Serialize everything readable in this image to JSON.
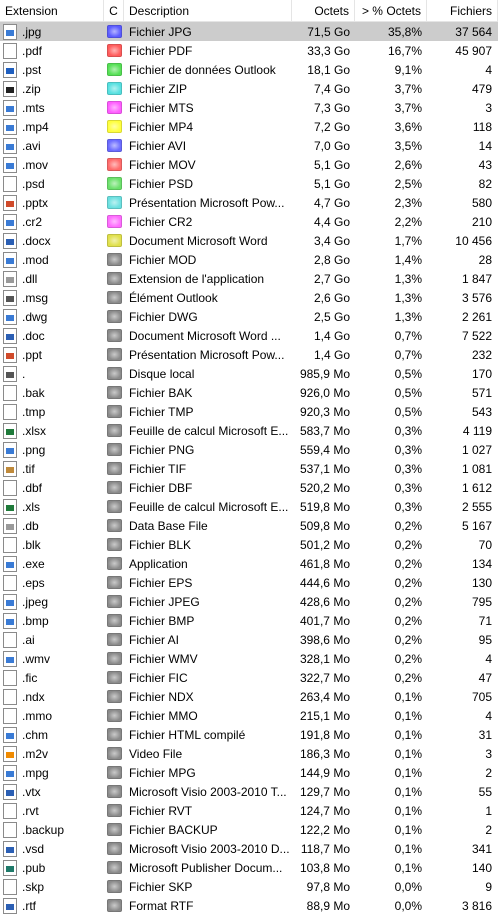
{
  "columns": {
    "extension": "Extension",
    "color": "C",
    "description": "Description",
    "octets": "Octets",
    "pct_octets": "> % Octets",
    "fichiers": "Fichiers"
  },
  "rows": [
    {
      "ext": ".jpg",
      "icon": "image-file-icon",
      "icon_color": "#3a7bd5",
      "color": "#5b5bff",
      "desc": "Fichier JPG",
      "octets": "71,5 Go",
      "pct": "35,8%",
      "files": "37 564",
      "selected": true
    },
    {
      "ext": ".pdf",
      "icon": "pdf-file-icon",
      "icon_color": "",
      "color": "#ff5b5b",
      "desc": "Fichier PDF",
      "octets": "33,3 Go",
      "pct": "16,7%",
      "files": "45 907"
    },
    {
      "ext": ".pst",
      "icon": "outlook-file-icon",
      "icon_color": "#1f5fbf",
      "color": "#55e055",
      "desc": "Fichier de données Outlook",
      "octets": "18,1 Go",
      "pct": "9,1%",
      "files": "4"
    },
    {
      "ext": ".zip",
      "icon": "archive-file-icon",
      "icon_color": "#222222",
      "color": "#55e0e0",
      "desc": "Fichier ZIP",
      "octets": "7,4 Go",
      "pct": "3,7%",
      "files": "479"
    },
    {
      "ext": ".mts",
      "icon": "video-file-icon",
      "icon_color": "#3a7bd5",
      "color": "#ff5bff",
      "desc": "Fichier MTS",
      "octets": "7,3 Go",
      "pct": "3,7%",
      "files": "3"
    },
    {
      "ext": ".mp4",
      "icon": "video-file-icon",
      "icon_color": "#3a7bd5",
      "color": "#ffff3a",
      "desc": "Fichier MP4",
      "octets": "7,2 Go",
      "pct": "3,6%",
      "files": "118"
    },
    {
      "ext": ".avi",
      "icon": "video-file-icon",
      "icon_color": "#3a7bd5",
      "color": "#6a6aff",
      "desc": "Fichier AVI",
      "octets": "7,0 Go",
      "pct": "3,5%",
      "files": "14"
    },
    {
      "ext": ".mov",
      "icon": "video-file-icon",
      "icon_color": "#3a7bd5",
      "color": "#ff6a6a",
      "desc": "Fichier MOV",
      "octets": "5,1 Go",
      "pct": "2,6%",
      "files": "43"
    },
    {
      "ext": ".psd",
      "icon": "file-icon",
      "icon_color": "",
      "color": "#6ae06a",
      "desc": "Fichier PSD",
      "octets": "5,1 Go",
      "pct": "2,5%",
      "files": "82"
    },
    {
      "ext": ".pptx",
      "icon": "powerpoint-file-icon",
      "icon_color": "#d04a2a",
      "color": "#6ae0e0",
      "desc": "Présentation Microsoft Pow...",
      "octets": "4,7 Go",
      "pct": "2,3%",
      "files": "580"
    },
    {
      "ext": ".cr2",
      "icon": "image-file-icon",
      "icon_color": "#3a7bd5",
      "color": "#ff6aff",
      "desc": "Fichier CR2",
      "octets": "4,4 Go",
      "pct": "2,2%",
      "files": "210"
    },
    {
      "ext": ".docx",
      "icon": "word-file-icon",
      "icon_color": "#2b5fb4",
      "color": "#e0e04a",
      "desc": "Document Microsoft Word",
      "octets": "3,4 Go",
      "pct": "1,7%",
      "files": "10 456"
    },
    {
      "ext": ".mod",
      "icon": "video-file-icon",
      "icon_color": "#3a7bd5",
      "color": "#8a8a8a",
      "desc": "Fichier MOD",
      "octets": "2,8 Go",
      "pct": "1,4%",
      "files": "28"
    },
    {
      "ext": ".dll",
      "icon": "gear-file-icon",
      "icon_color": "#9a9a9a",
      "color": "#8a8a8a",
      "desc": "Extension de l'application",
      "octets": "2,7 Go",
      "pct": "1,3%",
      "files": "1 847"
    },
    {
      "ext": ".msg",
      "icon": "envelope-icon",
      "icon_color": "#555555",
      "color": "#8a8a8a",
      "desc": "Élément Outlook",
      "octets": "2,6 Go",
      "pct": "1,3%",
      "files": "3 576"
    },
    {
      "ext": ".dwg",
      "icon": "image-file-icon",
      "icon_color": "#3a7bd5",
      "color": "#8a8a8a",
      "desc": "Fichier DWG",
      "octets": "2,5 Go",
      "pct": "1,3%",
      "files": "2 261"
    },
    {
      "ext": ".doc",
      "icon": "word-file-icon",
      "icon_color": "#2b5fb4",
      "color": "#8a8a8a",
      "desc": "Document Microsoft Word ...",
      "octets": "1,4 Go",
      "pct": "0,7%",
      "files": "7 522"
    },
    {
      "ext": ".ppt",
      "icon": "powerpoint-file-icon",
      "icon_color": "#d04a2a",
      "color": "#8a8a8a",
      "desc": "Présentation Microsoft Pow...",
      "octets": "1,4 Go",
      "pct": "0,7%",
      "files": "232"
    },
    {
      "ext": ".",
      "icon": "drive-icon",
      "icon_color": "#555555",
      "color": "#8a8a8a",
      "desc": "Disque local",
      "octets": "985,9 Mo",
      "pct": "0,5%",
      "files": "170"
    },
    {
      "ext": ".bak",
      "icon": "file-icon",
      "icon_color": "",
      "color": "#8a8a8a",
      "desc": "Fichier BAK",
      "octets": "926,0 Mo",
      "pct": "0,5%",
      "files": "571"
    },
    {
      "ext": ".tmp",
      "icon": "file-icon",
      "icon_color": "",
      "color": "#8a8a8a",
      "desc": "Fichier TMP",
      "octets": "920,3 Mo",
      "pct": "0,5%",
      "files": "543"
    },
    {
      "ext": ".xlsx",
      "icon": "excel-file-icon",
      "icon_color": "#1f7a3a",
      "color": "#8a8a8a",
      "desc": "Feuille de calcul Microsoft E...",
      "octets": "583,7 Mo",
      "pct": "0,3%",
      "files": "4 119"
    },
    {
      "ext": ".png",
      "icon": "image-file-icon",
      "icon_color": "#3a7bd5",
      "color": "#8a8a8a",
      "desc": "Fichier PNG",
      "octets": "559,4 Mo",
      "pct": "0,3%",
      "files": "1 027"
    },
    {
      "ext": ".tif",
      "icon": "image-file-icon",
      "icon_color": "#c08a3a",
      "color": "#8a8a8a",
      "desc": "Fichier TIF",
      "octets": "537,1 Mo",
      "pct": "0,3%",
      "files": "1 081"
    },
    {
      "ext": ".dbf",
      "icon": "file-icon",
      "icon_color": "",
      "color": "#8a8a8a",
      "desc": "Fichier DBF",
      "octets": "520,2 Mo",
      "pct": "0,3%",
      "files": "1 612"
    },
    {
      "ext": ".xls",
      "icon": "excel-file-icon",
      "icon_color": "#1f7a3a",
      "color": "#8a8a8a",
      "desc": "Feuille de calcul Microsoft E...",
      "octets": "519,8 Mo",
      "pct": "0,3%",
      "files": "2 555"
    },
    {
      "ext": ".db",
      "icon": "gear-file-icon",
      "icon_color": "#9a9a9a",
      "color": "#8a8a8a",
      "desc": "Data Base File",
      "octets": "509,8 Mo",
      "pct": "0,2%",
      "files": "5 167"
    },
    {
      "ext": ".blk",
      "icon": "file-icon",
      "icon_color": "",
      "color": "#8a8a8a",
      "desc": "Fichier BLK",
      "octets": "501,2 Mo",
      "pct": "0,2%",
      "files": "70"
    },
    {
      "ext": ".exe",
      "icon": "application-icon",
      "icon_color": "#3a7bd5",
      "color": "#8a8a8a",
      "desc": "Application",
      "octets": "461,8 Mo",
      "pct": "0,2%",
      "files": "134"
    },
    {
      "ext": ".eps",
      "icon": "file-icon",
      "icon_color": "",
      "color": "#8a8a8a",
      "desc": "Fichier EPS",
      "octets": "444,6 Mo",
      "pct": "0,2%",
      "files": "130"
    },
    {
      "ext": ".jpeg",
      "icon": "image-file-icon",
      "icon_color": "#3a7bd5",
      "color": "#8a8a8a",
      "desc": "Fichier JPEG",
      "octets": "428,6 Mo",
      "pct": "0,2%",
      "files": "795"
    },
    {
      "ext": ".bmp",
      "icon": "image-file-icon",
      "icon_color": "#3a7bd5",
      "color": "#8a8a8a",
      "desc": "Fichier BMP",
      "octets": "401,7 Mo",
      "pct": "0,2%",
      "files": "71"
    },
    {
      "ext": ".ai",
      "icon": "file-icon",
      "icon_color": "",
      "color": "#8a8a8a",
      "desc": "Fichier AI",
      "octets": "398,6 Mo",
      "pct": "0,2%",
      "files": "95"
    },
    {
      "ext": ".wmv",
      "icon": "video-file-icon",
      "icon_color": "#3a7bd5",
      "color": "#8a8a8a",
      "desc": "Fichier WMV",
      "octets": "328,1 Mo",
      "pct": "0,2%",
      "files": "4"
    },
    {
      "ext": ".fic",
      "icon": "file-icon",
      "icon_color": "",
      "color": "#8a8a8a",
      "desc": "Fichier FIC",
      "octets": "322,7 Mo",
      "pct": "0,2%",
      "files": "47"
    },
    {
      "ext": ".ndx",
      "icon": "file-icon",
      "icon_color": "",
      "color": "#8a8a8a",
      "desc": "Fichier NDX",
      "octets": "263,4 Mo",
      "pct": "0,1%",
      "files": "705"
    },
    {
      "ext": ".mmo",
      "icon": "file-icon",
      "icon_color": "",
      "color": "#8a8a8a",
      "desc": "Fichier MMO",
      "octets": "215,1 Mo",
      "pct": "0,1%",
      "files": "4"
    },
    {
      "ext": ".chm",
      "icon": "help-file-icon",
      "icon_color": "#3a7bd5",
      "color": "#8a8a8a",
      "desc": "Fichier HTML compilé",
      "octets": "191,8 Mo",
      "pct": "0,1%",
      "files": "31"
    },
    {
      "ext": ".m2v",
      "icon": "vlc-cone-icon",
      "icon_color": "#f08a00",
      "color": "#8a8a8a",
      "desc": "Video File",
      "octets": "186,3 Mo",
      "pct": "0,1%",
      "files": "3"
    },
    {
      "ext": ".mpg",
      "icon": "video-file-icon",
      "icon_color": "#3a7bd5",
      "color": "#8a8a8a",
      "desc": "Fichier MPG",
      "octets": "144,9 Mo",
      "pct": "0,1%",
      "files": "2"
    },
    {
      "ext": ".vtx",
      "icon": "visio-file-icon",
      "icon_color": "#2b5fb4",
      "color": "#8a8a8a",
      "desc": "Microsoft Visio 2003-2010 T...",
      "octets": "129,7 Mo",
      "pct": "0,1%",
      "files": "55"
    },
    {
      "ext": ".rvt",
      "icon": "file-icon",
      "icon_color": "",
      "color": "#8a8a8a",
      "desc": "Fichier RVT",
      "octets": "124,7 Mo",
      "pct": "0,1%",
      "files": "1"
    },
    {
      "ext": ".backup",
      "icon": "file-icon",
      "icon_color": "",
      "color": "#8a8a8a",
      "desc": "Fichier BACKUP",
      "octets": "122,2 Mo",
      "pct": "0,1%",
      "files": "2"
    },
    {
      "ext": ".vsd",
      "icon": "visio-file-icon",
      "icon_color": "#2b5fb4",
      "color": "#8a8a8a",
      "desc": "Microsoft Visio 2003-2010 D...",
      "octets": "118,7 Mo",
      "pct": "0,1%",
      "files": "341"
    },
    {
      "ext": ".pub",
      "icon": "publisher-file-icon",
      "icon_color": "#1f7a6a",
      "color": "#8a8a8a",
      "desc": "Microsoft Publisher Docum...",
      "octets": "103,8 Mo",
      "pct": "0,1%",
      "files": "140"
    },
    {
      "ext": ".skp",
      "icon": "file-icon",
      "icon_color": "",
      "color": "#8a8a8a",
      "desc": "Fichier SKP",
      "octets": "97,8 Mo",
      "pct": "0,0%",
      "files": "9"
    },
    {
      "ext": ".rtf",
      "icon": "word-file-icon",
      "icon_color": "#2b5fb4",
      "color": "#8a8a8a",
      "desc": "Format RTF",
      "octets": "88,9 Mo",
      "pct": "0,0%",
      "files": "3 816"
    }
  ]
}
